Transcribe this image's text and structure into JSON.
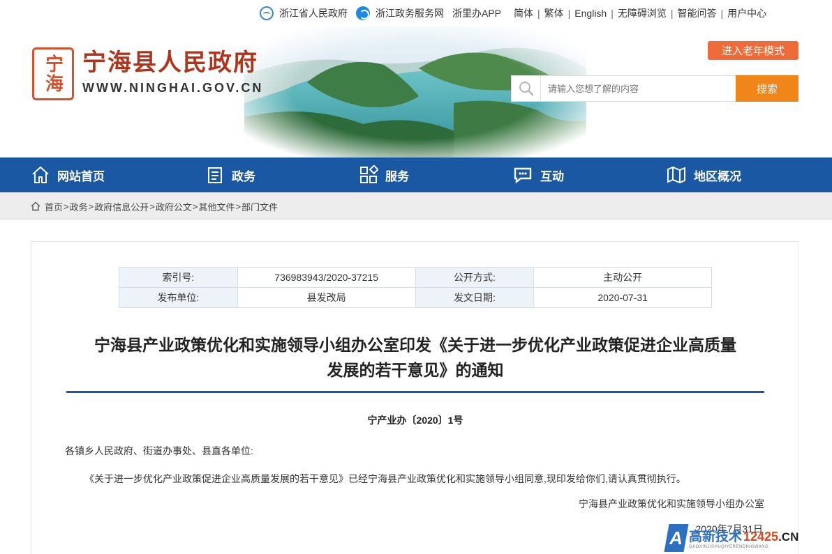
{
  "toplinks": {
    "zj_gov": "浙江省人民政府",
    "zj_service": "浙江政务服务网",
    "zlb_app": "浙里办APP",
    "simplified": "简体",
    "traditional": "繁体",
    "english": "English",
    "accessible": "无障碍浏览",
    "qa": "智能问答",
    "user_center": "用户中心",
    "sep": "|"
  },
  "logo": {
    "seal": "宁海",
    "name": "宁海县人民政府",
    "domain": "WWW.NINGHAI.GOV.CN"
  },
  "elder_mode": "进入老年模式",
  "search": {
    "placeholder": "请输入您想了解的内容",
    "button": "搜索"
  },
  "nav": [
    {
      "label": "网站首页",
      "icon": "home-icon"
    },
    {
      "label": "政务",
      "icon": "document-icon"
    },
    {
      "label": "服务",
      "icon": "grid-icon"
    },
    {
      "label": "互动",
      "icon": "chat-icon"
    },
    {
      "label": "地区概况",
      "icon": "map-icon"
    }
  ],
  "breadcrumb": [
    "首页",
    "政务",
    "政府信息公开",
    "政府公文",
    "其他文件",
    "部门文件"
  ],
  "breadcrumb_sep": ">",
  "meta": {
    "index_label": "索引号:",
    "index_value": "736983943/2020-37215",
    "open_label": "公开方式:",
    "open_value": "主动公开",
    "unit_label": "发布单位:",
    "unit_value": "县发改局",
    "date_label": "发文日期:",
    "date_value": "2020-07-31"
  },
  "article": {
    "title_line1": "宁海县产业政策优化和实施领导小组办公室印发《关于进一步优化产业政策促进企业高质量",
    "title_line2": "发展的若干意见》的通知",
    "doc_no": "宁产业办〔2020〕1号",
    "recipients": "各镇乡人民政府、街道办事处、县直各单位:",
    "body": "《关于进一步优化产业政策促进企业高质量发展的若干意见》已经宁海县产业政策优化和实施领导小组同意,现印发给你们,请认真贯彻执行。",
    "issuer": "宁海县产业政策优化和实施领导小组办公室",
    "date": "2020年7月31日"
  },
  "watermark": {
    "letter": "A",
    "cn": "高新技术",
    "num": "12425",
    "tld": ".CN",
    "en": "GAOXINJISHUQIYERENDINGWANG"
  },
  "colors": {
    "nav_blue": "#1b58a3",
    "search_orange": "#f0851a",
    "elder_orange": "#ee6c3a",
    "logo_red": "#b0341c"
  }
}
